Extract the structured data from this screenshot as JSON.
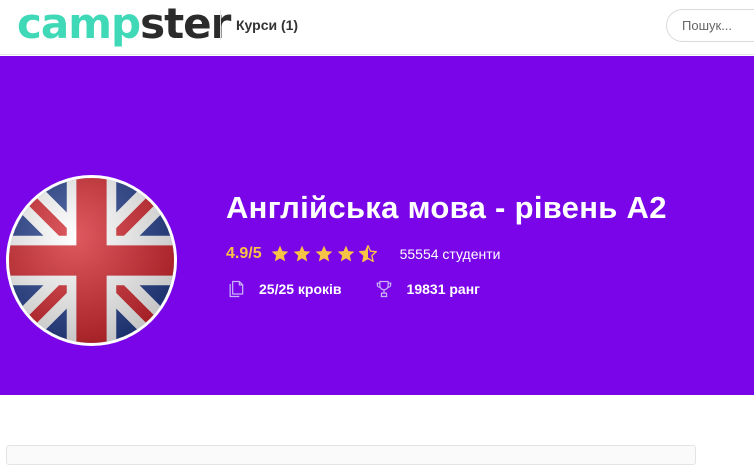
{
  "header": {
    "logo_part1": "camp",
    "logo_part2": "ster",
    "courses_link": "Курси (1)",
    "search_placeholder": "Пошук..."
  },
  "course": {
    "title": "Англійська мова - рівень А2",
    "rating_text": "4.9/5",
    "rating_value": 4.5,
    "rating_max": 5,
    "students": "55554 студенти",
    "steps": "25/25 кроків",
    "rank": "19831 ранг",
    "image": "uk-flag"
  },
  "colors": {
    "hero_bg": "#7a05e8",
    "star": "#f6c344",
    "logo_camp": "#3fd9b7",
    "logo_ster": "#2b2b2b"
  },
  "icons": {
    "steps": "copy-pages-icon",
    "rank": "trophy-icon",
    "rating": "star-icon"
  }
}
